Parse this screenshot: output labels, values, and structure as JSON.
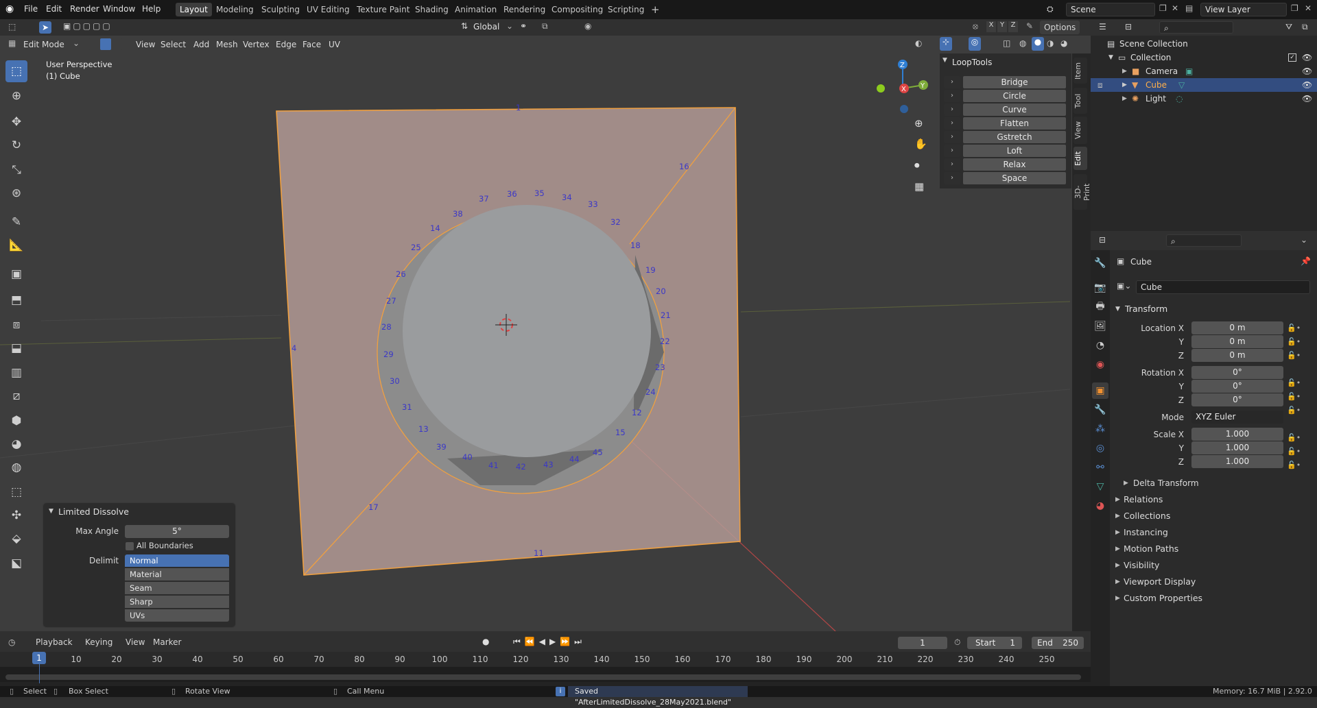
{
  "topbar": {
    "menus": [
      "File",
      "Edit",
      "Render",
      "Window",
      "Help"
    ],
    "workspaces": [
      "Layout",
      "Modeling",
      "Sculpting",
      "UV Editing",
      "Texture Paint",
      "Shading",
      "Animation",
      "Rendering",
      "Compositing",
      "Scripting"
    ],
    "active_workspace": "Layout",
    "add_tab": "+",
    "scene": "Scene",
    "view_layer": "View Layer"
  },
  "viewport_header": {
    "mode": "Edit Mode",
    "menus": [
      "View",
      "Select",
      "Add",
      "Mesh",
      "Vertex",
      "Edge",
      "Face",
      "UV"
    ],
    "transform_orientation": "Global",
    "axes": [
      "X",
      "Y",
      "Z"
    ],
    "options": "Options"
  },
  "viewport": {
    "perspective": "User Perspective",
    "object": "(1) Cube",
    "gizmo_labels": {
      "z": "Z",
      "y": "Y",
      "x": "X"
    },
    "vertex_labels": [
      "1",
      "4",
      "11",
      "16",
      "17",
      "36",
      "35",
      "34",
      "33",
      "32",
      "37",
      "38",
      "14",
      "25",
      "26",
      "27",
      "28",
      "29",
      "30",
      "31",
      "13",
      "39",
      "40",
      "41",
      "42",
      "43",
      "44",
      "45",
      "15",
      "12",
      "24",
      "23",
      "22",
      "21",
      "20",
      "19",
      "18"
    ]
  },
  "looptools": {
    "title": "LoopTools",
    "buttons": [
      "Bridge",
      "Circle",
      "Curve",
      "Flatten",
      "Gstretch",
      "Loft",
      "Relax",
      "Space"
    ]
  },
  "sidebar_tabs": [
    "Item",
    "Tool",
    "View",
    "Edit",
    "3D-Print"
  ],
  "sidebar_active_tab": "Edit",
  "redo_panel": {
    "title": "Limited Dissolve",
    "max_angle_label": "Max Angle",
    "max_angle_value": "5°",
    "all_boundaries": "All Boundaries",
    "delimit_label": "Delimit",
    "delimit_options": [
      "Normal",
      "Material",
      "Seam",
      "Sharp",
      "UVs"
    ],
    "delimit_selected": "Normal"
  },
  "outliner": {
    "root": "Scene Collection",
    "collection": "Collection",
    "items": [
      "Camera",
      "Cube",
      "Light"
    ],
    "selected": "Cube"
  },
  "properties": {
    "object_name": "Cube",
    "data_name": "Cube",
    "transform_title": "Transform",
    "location_label": "Location X",
    "location": [
      "0 m",
      "0 m",
      "0 m"
    ],
    "rotation_label": "Rotation X",
    "rotation": [
      "0°",
      "0°",
      "0°"
    ],
    "mode_label": "Mode",
    "mode_value": "XYZ Euler",
    "scale_label": "Scale X",
    "scale": [
      "1.000",
      "1.000",
      "1.000"
    ],
    "axis_y": "Y",
    "axis_z": "Z",
    "delta_transform": "Delta Transform",
    "sections": [
      "Relations",
      "Collections",
      "Instancing",
      "Motion Paths",
      "Visibility",
      "Viewport Display",
      "Custom Properties"
    ]
  },
  "timeline": {
    "menus": [
      "Playback",
      "Keying",
      "View",
      "Marker"
    ],
    "current_frame": "1",
    "start_label": "Start",
    "start": "1",
    "end_label": "End",
    "end": "250",
    "ticks": [
      "1",
      "10",
      "20",
      "30",
      "40",
      "50",
      "60",
      "70",
      "80",
      "90",
      "100",
      "110",
      "120",
      "130",
      "140",
      "150",
      "160",
      "170",
      "180",
      "190",
      "200",
      "210",
      "220",
      "230",
      "240",
      "250"
    ]
  },
  "statusbar": {
    "select": "Select",
    "box_select": "Box Select",
    "rotate_view": "Rotate View",
    "call_menu": "Call Menu",
    "message": "Saved \"AfterLimitedDissolve_28May2021.blend\"",
    "info_icon": "i",
    "memory": "Memory: 16.7 MiB | 2.92.0"
  },
  "colors": {
    "accent": "#4772b3",
    "plane": "#c9a49d",
    "edge_selected": "#f0a040",
    "vertex_label": "#3a37c8"
  }
}
